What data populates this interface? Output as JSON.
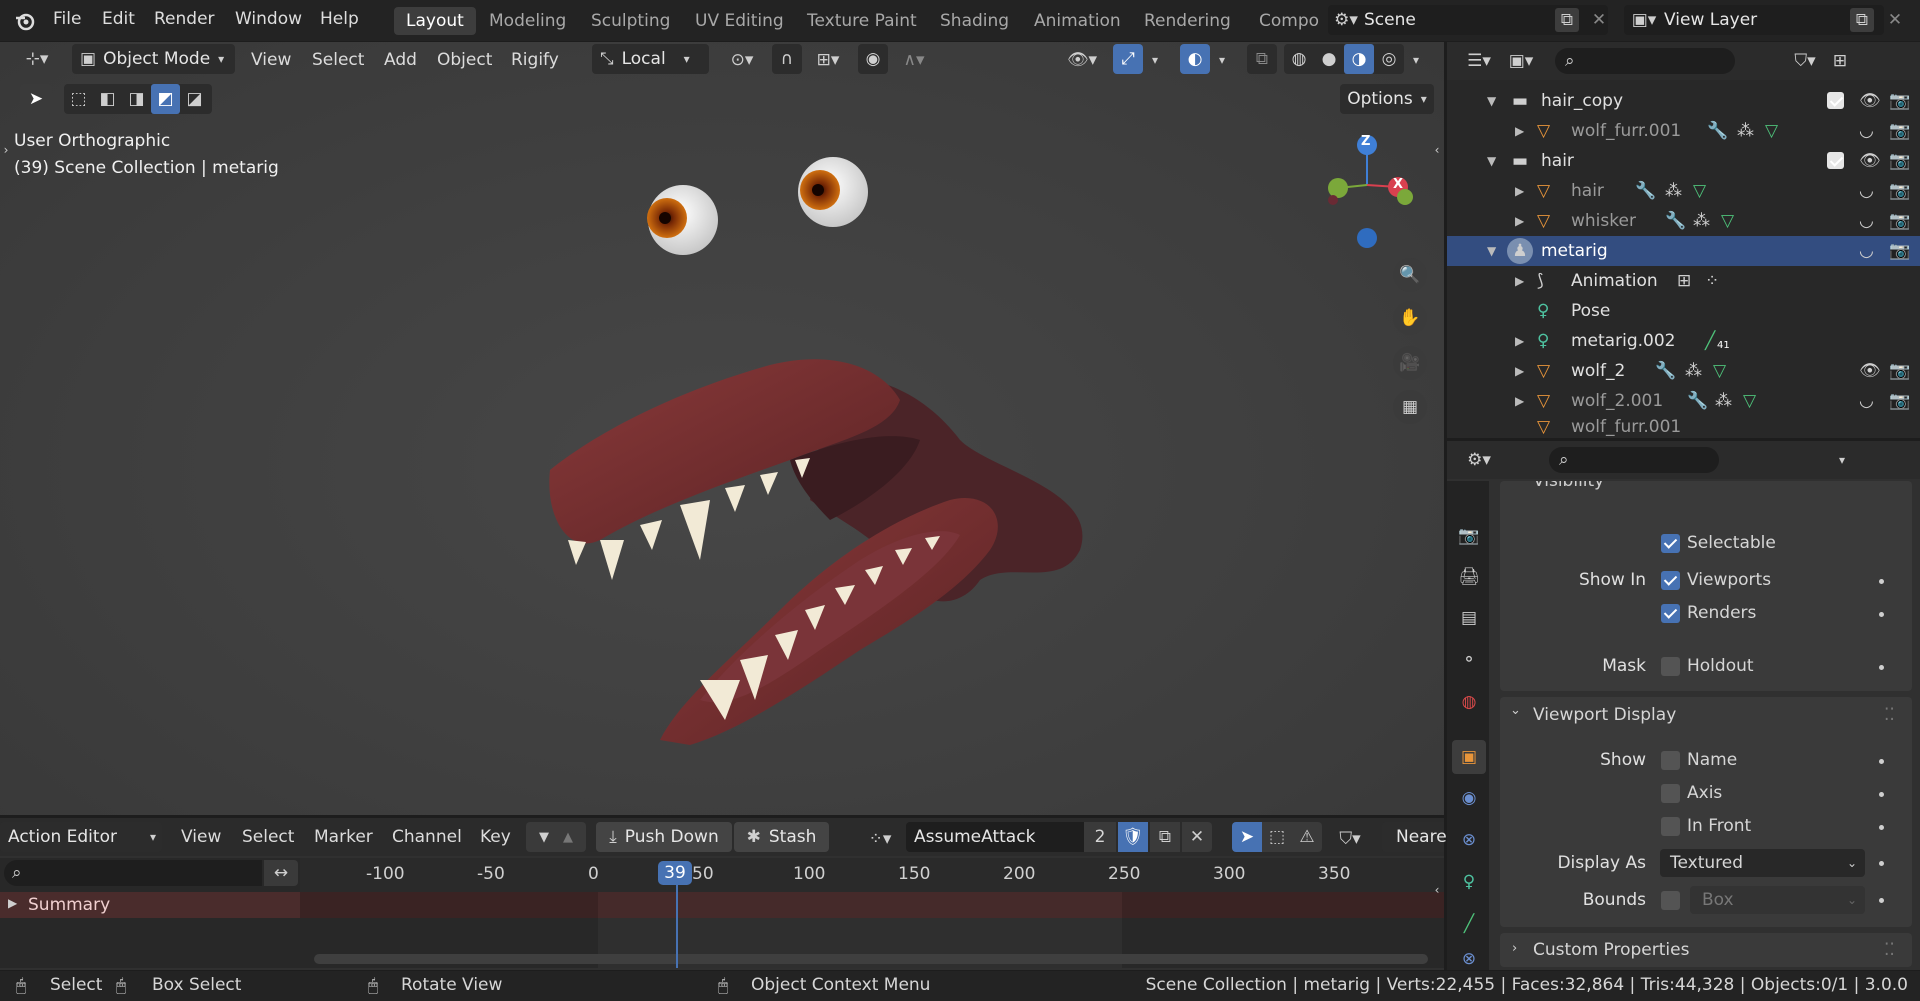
{
  "topbar": {
    "menus": [
      "File",
      "Edit",
      "Render",
      "Window",
      "Help"
    ],
    "workspaces": [
      "Layout",
      "Modeling",
      "Sculpting",
      "UV Editing",
      "Texture Paint",
      "Shading",
      "Animation",
      "Rendering",
      "Compo"
    ],
    "active_workspace": "Layout",
    "scene": "Scene",
    "view_layer": "View Layer"
  },
  "viewport": {
    "mode": "Object Mode",
    "menus": [
      "View",
      "Select",
      "Add",
      "Object",
      "Rigify"
    ],
    "transform_orientation": "Local",
    "options_label": "Options",
    "overlay_title": "User Orthographic",
    "overlay_subtitle": "(39) Scene Collection | metarig",
    "gizmo_axis_z": "Z",
    "gizmo_axis_x": "X"
  },
  "outliner": {
    "rows": [
      {
        "label": "hair_copy",
        "type": "collection"
      },
      {
        "label": "wolf_furr.001",
        "type": "mesh"
      },
      {
        "label": "hair",
        "type": "collection"
      },
      {
        "label": "hair",
        "type": "mesh"
      },
      {
        "label": "whisker",
        "type": "mesh"
      },
      {
        "label": "metarig",
        "type": "armature"
      },
      {
        "label": "Animation",
        "type": "anim"
      },
      {
        "label": "Pose",
        "type": "pose"
      },
      {
        "label": "metarig.002",
        "type": "armature"
      },
      {
        "label": "wolf_2",
        "type": "mesh"
      },
      {
        "label": "wolf_2.001",
        "type": "mesh"
      },
      {
        "label": "wolf_furr.001",
        "type": "mesh"
      }
    ],
    "bone_count": "41"
  },
  "properties": {
    "visibility_header": "Visibility",
    "selectable": "Selectable",
    "show_in": "Show In",
    "viewports": "Viewports",
    "renders": "Renders",
    "mask": "Mask",
    "holdout": "Holdout",
    "viewport_display_header": "Viewport Display",
    "show": "Show",
    "name": "Name",
    "axis": "Axis",
    "in_front": "In Front",
    "display_as": "Display As",
    "display_as_value": "Textured",
    "bounds": "Bounds",
    "bounds_value": "Box",
    "custom_properties": "Custom Properties"
  },
  "action_editor": {
    "mode": "Action Editor",
    "menus": [
      "View",
      "Select",
      "Marker",
      "Channel",
      "Key"
    ],
    "push_down": "Push Down",
    "stash": "Stash",
    "action_name": "AssumeAttack",
    "users": "2",
    "snap": "Neare",
    "current_frame": "39",
    "ticks": [
      "-100",
      "-50",
      "0",
      "50",
      "100",
      "150",
      "200",
      "250",
      "300",
      "350"
    ],
    "summary": "Summary"
  },
  "statusbar": {
    "select": "Select",
    "box_select": "Box Select",
    "rotate_view": "Rotate View",
    "context_menu": "Object Context Menu",
    "stats": "Scene Collection | metarig | Verts:22,455 | Faces:32,864 | Tris:44,328 | Objects:0/1 | 3.0.0"
  }
}
